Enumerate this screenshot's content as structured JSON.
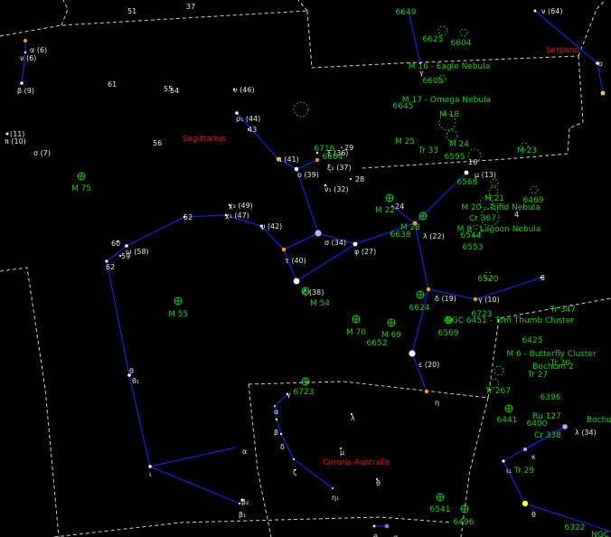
{
  "constellations": [
    {
      "id": "sgr",
      "name": "Sagittarius"
    },
    {
      "id": "cra",
      "name": "Corona Australis"
    },
    {
      "id": "ser",
      "name": "Serpens"
    }
  ],
  "stars": [
    {
      "id": "s_nu_oph",
      "label": "ν (64)",
      "color": "#ffffff"
    },
    {
      "id": "s_gamma_ser",
      "label": "γ",
      "color": "#ffffff"
    },
    {
      "id": "s_o_ser",
      "label": "o",
      "color": "#ffffff"
    },
    {
      "id": "s_eta_ser",
      "label": "η",
      "color": "#ffffff"
    },
    {
      "id": "s_alpha_mic",
      "label": "α (6)",
      "color": "#ffffff"
    },
    {
      "id": "s_nu_mic",
      "label": "ν (6)",
      "color": "#ffffff"
    },
    {
      "id": "s_beta_mic",
      "label": "β (9)",
      "color": "#ffffff"
    },
    {
      "id": "s_pi1",
      "label": "π (10)",
      "color": "#ffffff"
    },
    {
      "id": "s_pi_11",
      "label": "(11)",
      "color": "#ffffff"
    },
    {
      "id": "s_sigma7",
      "label": "σ (7)",
      "color": "#ffffff"
    },
    {
      "id": "s_upsilon",
      "label": "υ (46)",
      "color": "#ffffff"
    },
    {
      "id": "s_rho1",
      "label": "ρ₁ (44)",
      "color": "#ffffff"
    },
    {
      "id": "s_43",
      "label": "43",
      "color": "#ffffff"
    },
    {
      "id": "s_pi",
      "label": "π (41)",
      "color": "#ffffff"
    },
    {
      "id": "s_o",
      "label": "o (39)",
      "color": "#ffffff"
    },
    {
      "id": "s_xi2",
      "label": "ξ₂ (37)",
      "color": "#ffffff"
    },
    {
      "id": "s_xi1",
      "label": "ξ (36)",
      "color": "#ffffff"
    },
    {
      "id": "s_nu",
      "label": "ν₁ (32)",
      "color": "#ffffff"
    },
    {
      "id": "s_28",
      "label": "28",
      "color": "#ffffff"
    },
    {
      "id": "s_29",
      "label": "29",
      "color": "#ffffff"
    },
    {
      "id": "s_sigma",
      "label": "σ (34)",
      "color": "#ffffff"
    },
    {
      "id": "s_phi",
      "label": "φ (27)",
      "color": "#ffffff"
    },
    {
      "id": "s_tau",
      "label": "τ (40)",
      "color": "#ffffff"
    },
    {
      "id": "s_zeta",
      "label": "ζ (38)",
      "color": "#ffffff"
    },
    {
      "id": "s_psi",
      "label": "ψ (42)",
      "color": "#ffffff"
    },
    {
      "id": "s_chi3",
      "label": "χ₃ (49)",
      "color": "#ffffff"
    },
    {
      "id": "s_chi1",
      "label": "χ₁ (47)",
      "color": "#ffffff"
    },
    {
      "id": "s_52",
      "label": "52",
      "color": "#ffffff"
    },
    {
      "id": "s_60",
      "label": "60",
      "color": "#ffffff"
    },
    {
      "id": "s_omega",
      "label": "ω (58)",
      "color": "#ffffff"
    },
    {
      "id": "s_59",
      "label": "59",
      "color": "#ffffff"
    },
    {
      "id": "s_62",
      "label": "62",
      "color": "#ffffff"
    },
    {
      "id": "s_theta1",
      "label": "θ₁",
      "color": "#ffffff"
    },
    {
      "id": "s_theta",
      "label": "θ",
      "color": "#ffffff"
    },
    {
      "id": "s_iota",
      "label": "ι",
      "color": "#ffffff"
    },
    {
      "id": "s_alpha_sgr",
      "label": "α",
      "color": "#ffffff"
    },
    {
      "id": "s_beta2",
      "label": "β₂",
      "color": "#ffffff"
    },
    {
      "id": "s_beta1",
      "label": "β₁",
      "color": "#ffffff"
    },
    {
      "id": "s_mu13",
      "label": "μ (13)",
      "color": "#ffffff"
    },
    {
      "id": "s_lambda",
      "label": "λ (22)",
      "color": "#ffffff"
    },
    {
      "id": "s_24",
      "label": "24",
      "color": "#ffffff"
    },
    {
      "id": "s_delta",
      "label": "δ (19)",
      "color": "#ffffff"
    },
    {
      "id": "s_epsilon",
      "label": "ε (20)",
      "color": "#ffffff"
    },
    {
      "id": "s_eta_sgr",
      "label": "η",
      "color": "#ffffff"
    },
    {
      "id": "s_gamma_sgr",
      "label": "γ (10)",
      "color": "#ffffff"
    },
    {
      "id": "s_4",
      "label": "4",
      "color": "#ffffff"
    },
    {
      "id": "s_3",
      "label": "3",
      "color": "#ffffff"
    },
    {
      "id": "s_16",
      "label": "16",
      "color": "#ffffff"
    },
    {
      "id": "s_gamma_cra",
      "label": "γ",
      "color": "#ffffff"
    },
    {
      "id": "s_alpha_cra",
      "label": "α",
      "color": "#ffffff"
    },
    {
      "id": "s_beta_cra",
      "label": "β",
      "color": "#ffffff"
    },
    {
      "id": "s_delta_cra",
      "label": "δ",
      "color": "#ffffff"
    },
    {
      "id": "s_zeta_cra",
      "label": "ζ",
      "color": "#ffffff"
    },
    {
      "id": "s_eta1_cra",
      "label": "η₁",
      "color": "#ffffff"
    },
    {
      "id": "s_lambda_cra",
      "label": "λ",
      "color": "#ffffff"
    },
    {
      "id": "s_mu_cra",
      "label": "μ",
      "color": "#ffffff"
    },
    {
      "id": "s_theta_cra",
      "label": "θ",
      "color": "#ffffff"
    },
    {
      "id": "s_kappa_sco",
      "label": "κ",
      "color": "#ffffff"
    },
    {
      "id": "s_iota_sco",
      "label": "ι₁",
      "color": "#ffffff"
    },
    {
      "id": "s_theta_sco",
      "label": "θ",
      "color": "#ffffff"
    },
    {
      "id": "s_34_sco",
      "label": "λ (34)",
      "color": "#ffffff"
    },
    {
      "id": "s_alpha_ara",
      "label": "α",
      "color": "#ffffff"
    },
    {
      "id": "s_theta_ara",
      "label": "θ",
      "color": "#ffffff"
    },
    {
      "id": "s_51",
      "label": "51",
      "color": "#ffffff"
    },
    {
      "id": "s_37",
      "label": "37",
      "color": "#ffffff"
    },
    {
      "id": "s_61",
      "label": "61",
      "color": "#ffffff"
    },
    {
      "id": "s_55",
      "label": "55",
      "color": "#ffffff"
    },
    {
      "id": "s_54",
      "label": "54",
      "color": "#ffffff"
    },
    {
      "id": "s_56",
      "label": "56",
      "color": "#ffffff"
    }
  ],
  "dsos": [
    {
      "id": "d6649",
      "label": "6649"
    },
    {
      "id": "d6625",
      "label": "6625"
    },
    {
      "id": "d6604",
      "label": "6604"
    },
    {
      "id": "d6605",
      "label": "6605"
    },
    {
      "id": "dM16",
      "label": "M 16 - Eagle Nebula"
    },
    {
      "id": "dM17",
      "label": "M 17 - Omega Nebula"
    },
    {
      "id": "d6645",
      "label": "6645"
    },
    {
      "id": "dM18",
      "label": "M 18"
    },
    {
      "id": "dM25",
      "label": "M 25"
    },
    {
      "id": "dM24",
      "label": "M 24"
    },
    {
      "id": "dTr33",
      "label": "Tr 33"
    },
    {
      "id": "d6595",
      "label": "6595"
    },
    {
      "id": "dM23",
      "label": "M 23"
    },
    {
      "id": "d6716",
      "label": "6716"
    },
    {
      "id": "d6604b",
      "label": "6604"
    },
    {
      "id": "d6568",
      "label": "6568"
    },
    {
      "id": "dM21",
      "label": "M 21"
    },
    {
      "id": "d6469",
      "label": "6469"
    },
    {
      "id": "dM20",
      "label": "M 20 - Trifid Nebula"
    },
    {
      "id": "dCr367",
      "label": "Cr 367"
    },
    {
      "id": "dM8",
      "label": "M 8 - Lagoon Nebula"
    },
    {
      "id": "d6544",
      "label": "6544"
    },
    {
      "id": "d6553",
      "label": "6553"
    },
    {
      "id": "dM22",
      "label": "M 22"
    },
    {
      "id": "dM28",
      "label": "M 28"
    },
    {
      "id": "d6638",
      "label": "6638"
    },
    {
      "id": "dM75",
      "label": "M 75"
    },
    {
      "id": "dM55",
      "label": "M 55"
    },
    {
      "id": "dM54",
      "label": "M 54"
    },
    {
      "id": "d6520",
      "label": "6520"
    },
    {
      "id": "d6624",
      "label": "6624"
    },
    {
      "id": "d6723b",
      "label": "6723"
    },
    {
      "id": "dTr347",
      "label": "Tr 347"
    },
    {
      "id": "dNGC6451",
      "label": "NGC 6451 - Tom Thumb Cluster"
    },
    {
      "id": "dM70",
      "label": "M 70"
    },
    {
      "id": "dM69",
      "label": "M 69"
    },
    {
      "id": "d6652",
      "label": "6652"
    },
    {
      "id": "d6569",
      "label": "6569"
    },
    {
      "id": "d6425",
      "label": "6425"
    },
    {
      "id": "dM6",
      "label": "M 6 - Butterfly Cluster"
    },
    {
      "id": "dTr30",
      "label": "Tr 30"
    },
    {
      "id": "dBochum2",
      "label": "Bochum 2"
    },
    {
      "id": "dTr27",
      "label": "Tr 27"
    },
    {
      "id": "dTr267",
      "label": "Tr 267"
    },
    {
      "id": "d6723",
      "label": "6723"
    },
    {
      "id": "d6396",
      "label": "6396"
    },
    {
      "id": "d6441",
      "label": "6441"
    },
    {
      "id": "dRu127",
      "label": "Ru 127"
    },
    {
      "id": "d6400",
      "label": "6400"
    },
    {
      "id": "dCr338",
      "label": "Cr 338"
    },
    {
      "id": "dBochum",
      "label": "Bochu"
    },
    {
      "id": "dTr29",
      "label": "Tr 29"
    },
    {
      "id": "d6541",
      "label": "6541"
    },
    {
      "id": "d6496",
      "label": "6496"
    },
    {
      "id": "d6322",
      "label": "6322"
    },
    {
      "id": "dNGC",
      "label": "NGC"
    }
  ],
  "colors": {
    "background": "#000000",
    "constellation_line": "#1b1bd6",
    "boundary": "#cfcfcf",
    "dso": "#16d016",
    "constellation_name": "#e81010",
    "star_label": "#e6e6e6"
  }
}
